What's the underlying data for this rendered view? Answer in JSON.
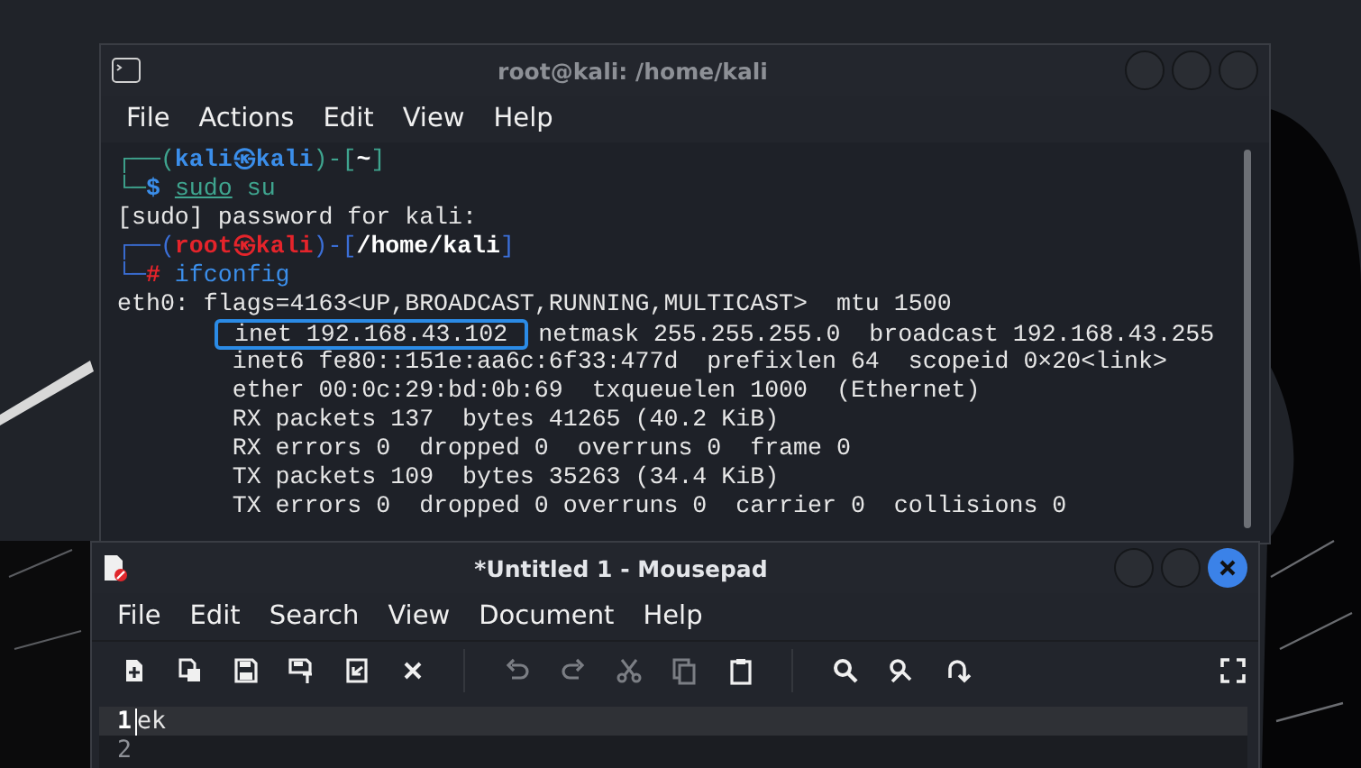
{
  "terminal": {
    "title": "root@kali: /home/kali",
    "menu": [
      "File",
      "Actions",
      "Edit",
      "View",
      "Help"
    ],
    "lines": [
      {
        "kind": "segments",
        "segments": [
          {
            "text": "┌──(",
            "color": "#3fa58f",
            "bold": false,
            "underline": false
          },
          {
            "text": "kali㉿kali",
            "color": "#3b8eea",
            "bold": true,
            "underline": false
          },
          {
            "text": ")-[",
            "color": "#3fa58f",
            "bold": false,
            "underline": false
          },
          {
            "text": "~",
            "color": "#ffffff",
            "bold": true,
            "underline": false
          },
          {
            "text": "]",
            "color": "#3fa58f",
            "bold": false,
            "underline": false
          }
        ]
      },
      {
        "kind": "segments",
        "segments": [
          {
            "text": "└─",
            "color": "#3fa58f",
            "underline": false
          },
          {
            "text": "$ ",
            "color": "#3b8eea",
            "bold": true,
            "underline": false
          },
          {
            "text": "sudo",
            "color": "#3fa58f",
            "bold": false,
            "underline": true
          },
          {
            "text": " su",
            "color": "#3fa58f",
            "bold": false,
            "underline": false
          }
        ]
      },
      {
        "kind": "plain",
        "text": "[sudo] password for kali:"
      },
      {
        "kind": "segments",
        "segments": [
          {
            "text": "┌──(",
            "color": "#3b6fd8",
            "bold": false,
            "underline": false
          },
          {
            "text": "root㉿kali",
            "color": "#e5242b",
            "bold": true,
            "underline": false
          },
          {
            "text": ")-[",
            "color": "#3b6fd8",
            "bold": false,
            "underline": false
          },
          {
            "text": "/home/kali",
            "color": "#ffffff",
            "bold": true,
            "underline": false
          },
          {
            "text": "]",
            "color": "#3b6fd8",
            "bold": false,
            "underline": false
          }
        ]
      },
      {
        "kind": "segments",
        "segments": [
          {
            "text": "└─",
            "color": "#3b6fd8",
            "underline": false
          },
          {
            "text": "#",
            "color": "#e5242b",
            "bold": true,
            "underline": false
          },
          {
            "text": " ifconfig",
            "color": "#3b8eea",
            "bold": false,
            "underline": false
          }
        ]
      },
      {
        "kind": "plain",
        "text": "eth0: flags=4163<UP,BROADCAST,RUNNING,MULTICAST>  mtu 1500"
      },
      {
        "kind": "annotated",
        "marked": "inet 192.168.43.102",
        "rest": "netmask 255.255.255.0  broadcast 192.168.43.255"
      },
      {
        "kind": "plain",
        "text": "        inet6 fe80::151e:aa6c:6f33:477d  prefixlen 64  scopeid 0×20<link>"
      },
      {
        "kind": "plain",
        "text": "        ether 00:0c:29:bd:0b:69  txqueuelen 1000  (Ethernet)"
      },
      {
        "kind": "plain",
        "text": "        RX packets 137  bytes 41265 (40.2 KiB)"
      },
      {
        "kind": "plain",
        "text": "        RX errors 0  dropped 0  overruns 0  frame 0"
      },
      {
        "kind": "plain",
        "text": "        TX packets 109  bytes 35263 (34.4 KiB)"
      },
      {
        "kind": "plain",
        "text": "        TX errors 0  dropped 0 overruns 0  carrier 0  collisions 0"
      }
    ]
  },
  "mousepad": {
    "title": "*Untitled 1 - Mousepad",
    "menu": [
      "File",
      "Edit",
      "Search",
      "View",
      "Document",
      "Help"
    ],
    "toolbar": [
      {
        "kind": "new",
        "disabled": false
      },
      {
        "kind": "new-window",
        "disabled": false
      },
      {
        "kind": "save",
        "disabled": false
      },
      {
        "kind": "save-as",
        "disabled": false
      },
      {
        "kind": "reload",
        "disabled": false
      },
      {
        "kind": "close",
        "disabled": false
      },
      {
        "kind": "separator"
      },
      {
        "kind": "undo",
        "disabled": true
      },
      {
        "kind": "redo",
        "disabled": true
      },
      {
        "kind": "cut",
        "disabled": true
      },
      {
        "kind": "copy",
        "disabled": true
      },
      {
        "kind": "paste",
        "disabled": false
      },
      {
        "kind": "separator"
      },
      {
        "kind": "find",
        "disabled": false
      },
      {
        "kind": "replace",
        "disabled": false
      },
      {
        "kind": "goto",
        "disabled": false
      },
      {
        "kind": "spacer"
      },
      {
        "kind": "fullscreen",
        "disabled": false
      }
    ],
    "lines": [
      {
        "number": "1",
        "text": "ek",
        "current": true
      },
      {
        "number": "2",
        "current": false
      }
    ]
  }
}
